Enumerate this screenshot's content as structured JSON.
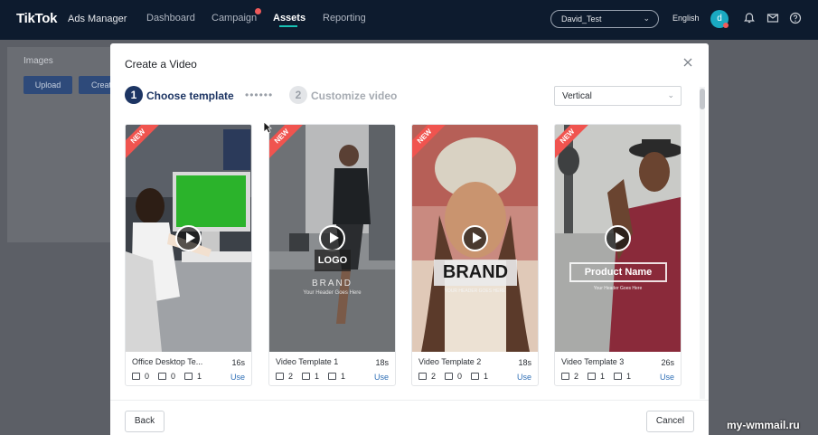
{
  "nav": {
    "logo": "TikTok",
    "logo_sub": "Ads Manager",
    "items": [
      {
        "label": "Dashboard",
        "active": false
      },
      {
        "label": "Campaign",
        "active": false,
        "badge": true
      },
      {
        "label": "Assets",
        "active": true
      },
      {
        "label": "Reporting",
        "active": false
      }
    ],
    "account": "David_Test",
    "language": "English",
    "avatar_letter": "d"
  },
  "background_page": {
    "section_title": "Images",
    "upload_label": "Upload",
    "create_label": "Create"
  },
  "modal": {
    "title": "Create a Video",
    "steps": [
      {
        "number": "1",
        "label": "Choose template",
        "active": true
      },
      {
        "number": "2",
        "label": "Customize video",
        "active": false
      }
    ],
    "orientation": "Vertical",
    "templates": [
      {
        "name": "Office Desktop Te...",
        "duration": "16s",
        "text_count": "0",
        "image_count": "0",
        "video_count": "1",
        "use_label": "Use",
        "ribbon": "NEW",
        "overlay_text": ""
      },
      {
        "name": "Video Template 1",
        "duration": "18s",
        "text_count": "2",
        "image_count": "1",
        "video_count": "1",
        "use_label": "Use",
        "ribbon": "NEW",
        "overlay_text": "LOGO",
        "overlay_brand": "BRAND",
        "overlay_sub": "Your Header Goes Here"
      },
      {
        "name": "Video Template 2",
        "duration": "18s",
        "text_count": "2",
        "image_count": "0",
        "video_count": "1",
        "use_label": "Use",
        "ribbon": "NEW",
        "overlay_text": "BRAND",
        "overlay_sub": "YOUR HEADER GOES HERE"
      },
      {
        "name": "Video Template 3",
        "duration": "26s",
        "text_count": "2",
        "image_count": "1",
        "video_count": "1",
        "use_label": "Use",
        "ribbon": "NEW",
        "overlay_text": "Product Name",
        "overlay_sub": "Your Header Goes Here"
      }
    ],
    "back_label": "Back",
    "cancel_label": "Cancel"
  },
  "watermark": "my-wmmail.ru",
  "colors": {
    "nav_bg": "#0d1b2e",
    "primary": "#1d3563",
    "accent_teal": "#19c3b5",
    "ribbon_red": "#f0544f",
    "link_blue": "#2f6fb6"
  }
}
